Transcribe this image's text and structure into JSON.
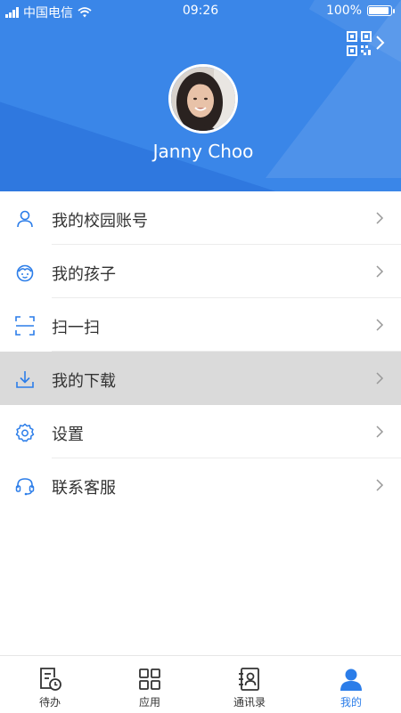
{
  "status_bar": {
    "carrier": "中国电信",
    "time": "09:26",
    "battery": "100%",
    "battery_level": 1.0,
    "signal_bars": 4
  },
  "profile": {
    "name": "Janny Choo"
  },
  "menu": {
    "items": [
      {
        "label": "我的校园账号",
        "icon": "user-icon"
      },
      {
        "label": "我的孩子",
        "icon": "child-face-icon"
      },
      {
        "label": "扫一扫",
        "icon": "scan-icon"
      },
      {
        "label": "我的下载",
        "icon": "download-icon"
      },
      {
        "label": "设置",
        "icon": "gear-icon"
      },
      {
        "label": "联系客服",
        "icon": "headset-icon"
      }
    ],
    "active_index": 3
  },
  "tabbar": {
    "tabs": [
      {
        "label": "待办",
        "icon": "todo-clock-icon"
      },
      {
        "label": "应用",
        "icon": "apps-grid-icon"
      },
      {
        "label": "通讯录",
        "icon": "contacts-icon"
      },
      {
        "label": "我的",
        "icon": "person-icon"
      }
    ],
    "active_index": 3
  },
  "colors": {
    "header_blue": "#3a86e8",
    "accent": "#2b7de9",
    "active_row": "#dadada"
  }
}
